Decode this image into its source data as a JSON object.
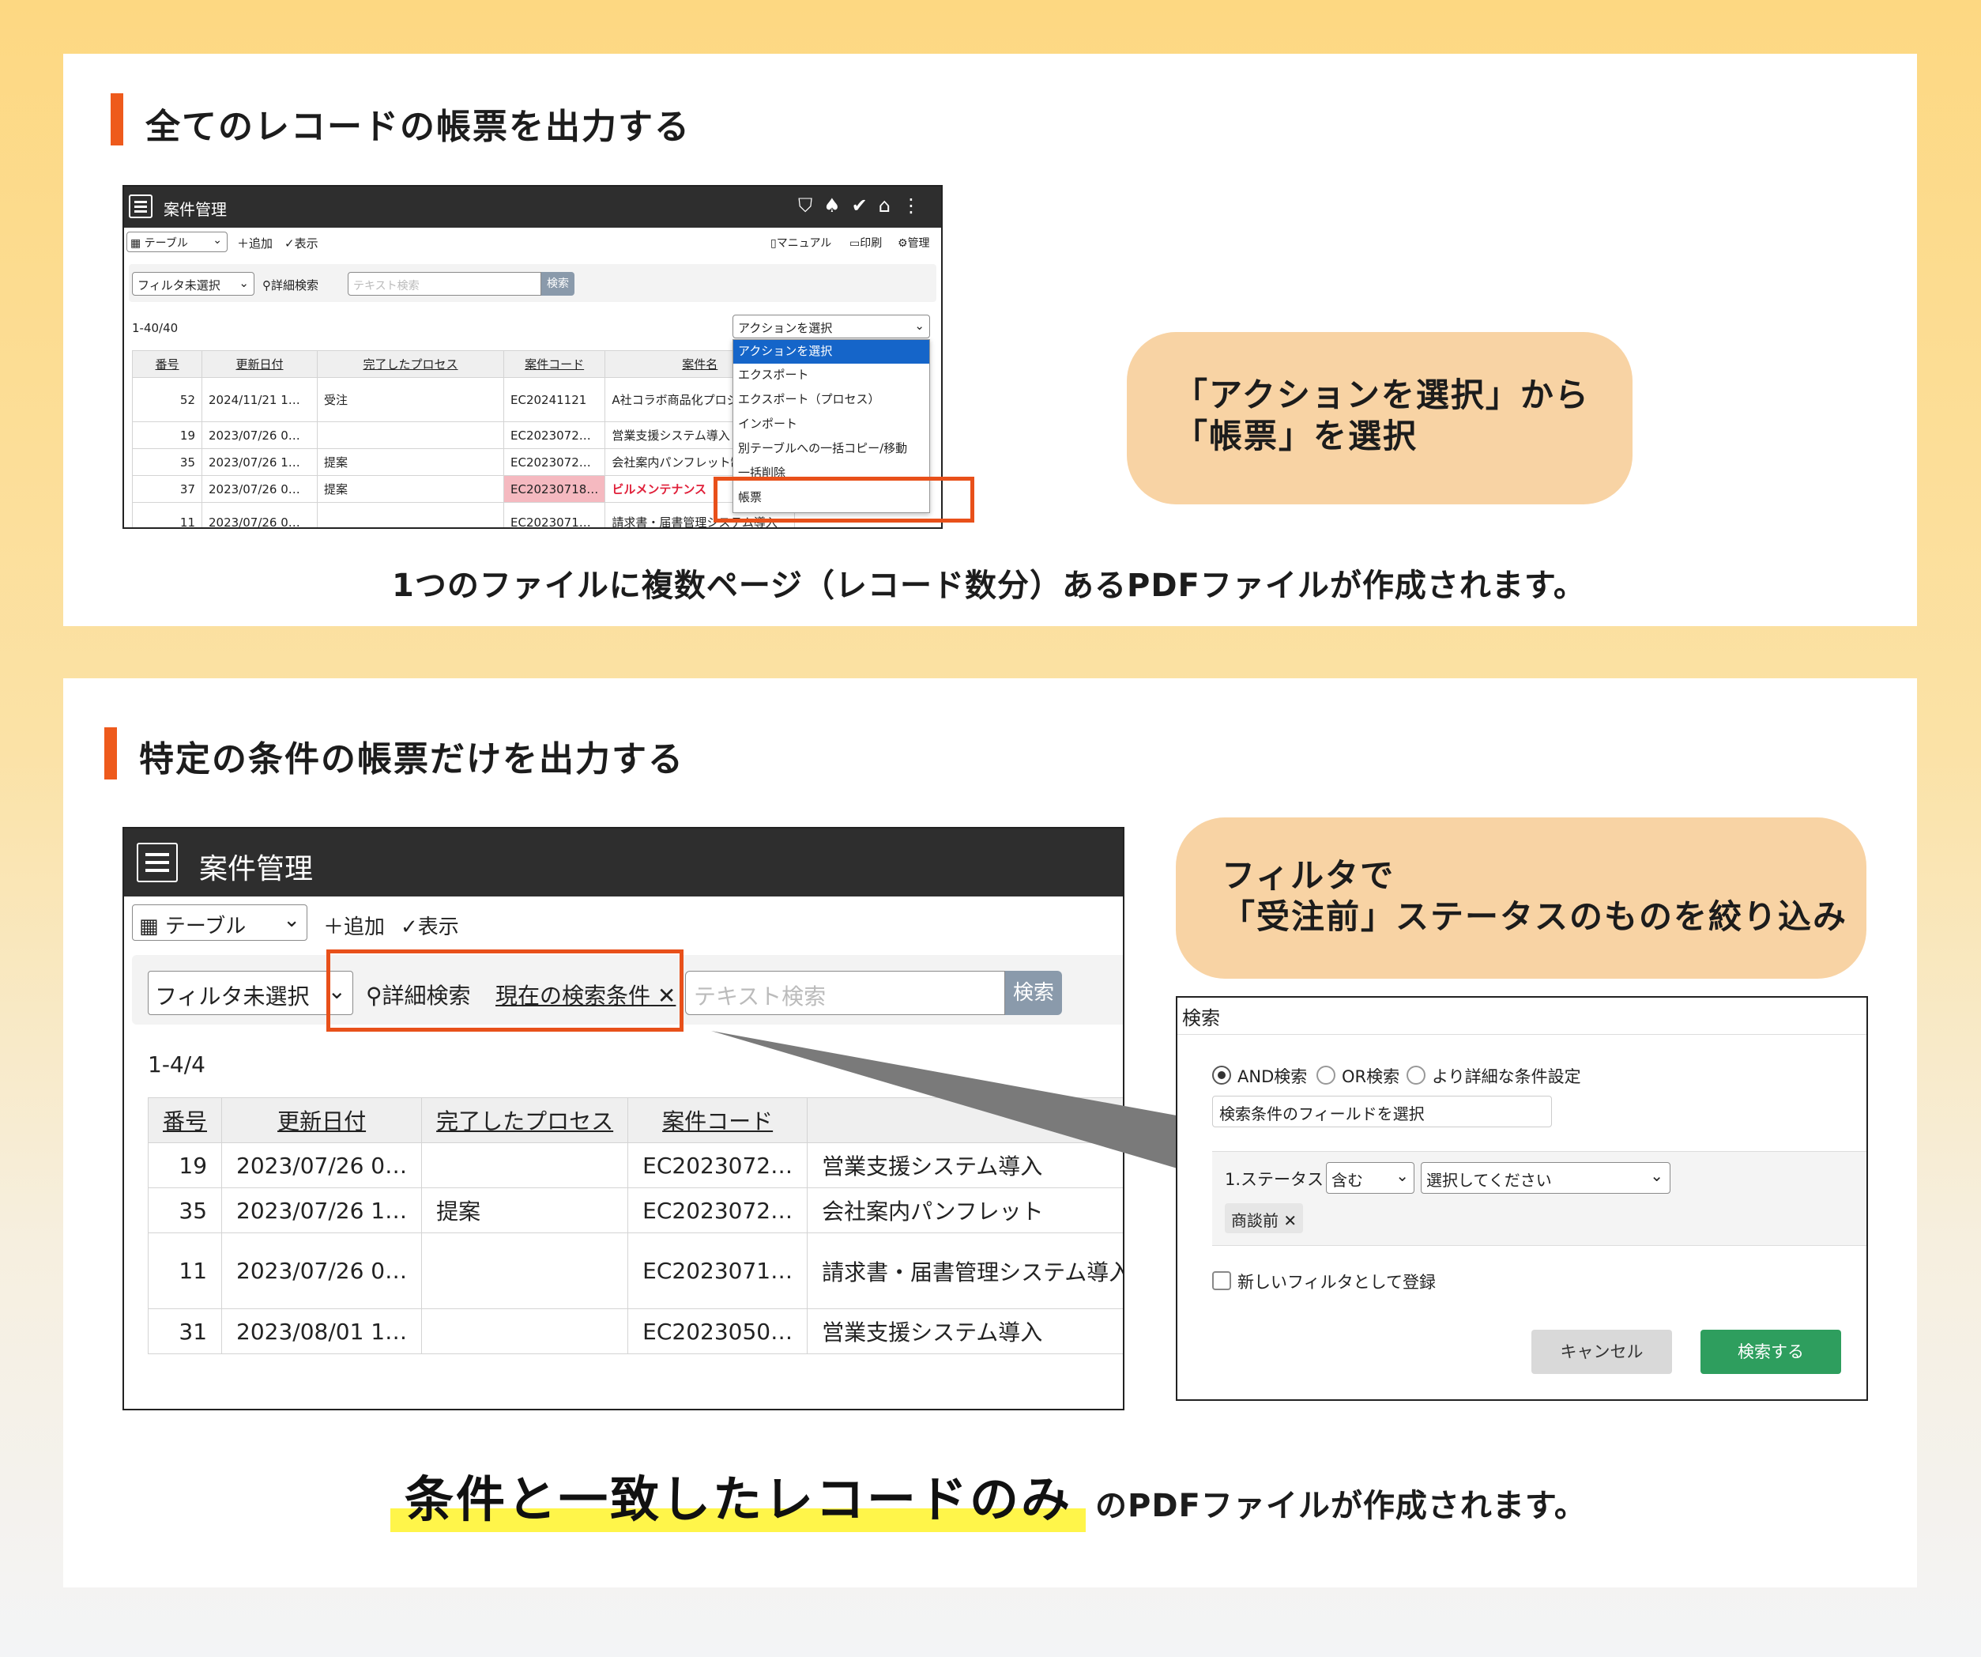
{
  "section1": {
    "title": "全てのレコードの帳票を出力する",
    "bubble_line1": "「アクションを選択」から",
    "bubble_line2": "「帳票」を選択",
    "caption": "1つのファイルに複数ページ（レコード数分）あるPDFファイルが作成されます。",
    "app": {
      "title": "案件管理",
      "view_select": "▦ テーブル",
      "add_label": "＋追加",
      "display_label": "✓表示",
      "manual_label": "マニュアル",
      "print_label": "印刷",
      "admin_label": "管理",
      "filter_select": "フィルタ未選択",
      "detail_search": "詳細検索",
      "text_search_placeholder": "テキスト検索",
      "search_button": "検索",
      "count": "1-40/40",
      "action_select": "アクションを選択",
      "headers": [
        "番号",
        "更新日付",
        "完了したプロセス",
        "案件コード",
        "案件名"
      ],
      "rows": [
        [
          "52",
          "2024/11/21 1…",
          "受注",
          "EC20241121",
          "A社コラボ商品化プロジェクト"
        ],
        [
          "19",
          "2023/07/26 0…",
          "",
          "EC2023072…",
          "営業支援システム導入"
        ],
        [
          "35",
          "2023/07/26 1…",
          "提案",
          "EC2023072…",
          "会社案内パンフレット制作"
        ],
        [
          "37",
          "2023/07/26 0…",
          "提案",
          "EC20230718…",
          "ビルメンテナンス"
        ],
        [
          "11",
          "2023/07/26 0…",
          "",
          "EC2023071…",
          "請求書・届書管理システム導入"
        ]
      ],
      "menu": [
        "アクションを選択",
        "エクスポート",
        "エクスポート（プロセス）",
        "インポート",
        "別テーブルへの一括コピー/移動",
        "一括削除",
        "帳票"
      ]
    }
  },
  "section2": {
    "title": "特定の条件の帳票だけを出力する",
    "bubble_line1": "フィルタで",
    "bubble_line2": "「受注前」ステータスのものを絞り込み",
    "caption_highlight": "条件と一致したレコードのみ",
    "caption_rest": "のPDFファイルが作成されます。",
    "app": {
      "title": "案件管理",
      "view_select": "▦ テーブル",
      "add_label": "＋追加",
      "display_label": "✓表示",
      "filter_select": "フィルタ未選択",
      "detail_search": "詳細検索",
      "current_condition": "現在の検索条件",
      "text_search_placeholder": "テキスト検索",
      "search_button": "検索",
      "count": "1-4/4",
      "headers": [
        "番号",
        "更新日付",
        "完了したプロセス",
        "案件コード",
        ""
      ],
      "rows": [
        [
          "19",
          "2023/07/26 0…",
          "",
          "EC2023072…",
          "営業支援システム導入"
        ],
        [
          "35",
          "2023/07/26 1…",
          "提案",
          "EC2023072…",
          "会社案内パンフレット"
        ],
        [
          "11",
          "2023/07/26 0…",
          "",
          "EC2023071…",
          "請求書・届書管理システム導入"
        ],
        [
          "31",
          "2023/08/01 1…",
          "",
          "EC2023050…",
          "営業支援システム導入"
        ]
      ]
    },
    "dialog": {
      "title": "検索",
      "radio_and": "AND検索",
      "radio_or": "OR検索",
      "radio_detail": "より詳細な条件設定",
      "field_select": "検索条件のフィールドを選択",
      "cond_label": "1.ステータス",
      "cond_op": "含む",
      "cond_value": "選択してください",
      "tag": "商談前",
      "save_filter": "新しいフィルタとして登録",
      "cancel": "キャンセル",
      "submit": "検索する"
    }
  },
  "colors": {
    "accent": "#ee5a1c",
    "bubble": "#f8d3a4",
    "highlight": "#fff54a",
    "dark_header": "#2e2e2e",
    "submit_green": "#2e9e5e"
  }
}
